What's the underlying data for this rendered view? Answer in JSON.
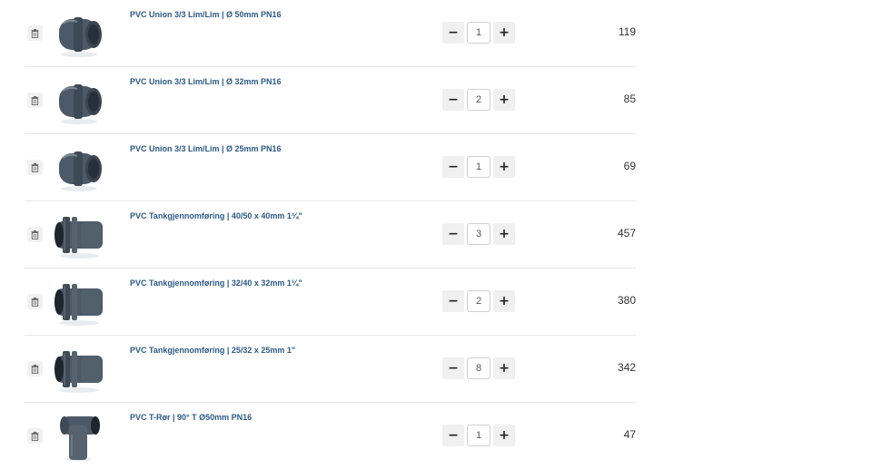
{
  "cart": {
    "items": [
      {
        "name": "PVC Union 3/3 Lim/Lim | Ø 50mm PN16",
        "quantity": "1",
        "price": "119",
        "image": "pvc-union-icon"
      },
      {
        "name": "PVC Union 3/3 Lim/Lim | Ø 32mm PN16",
        "quantity": "2",
        "price": "85",
        "image": "pvc-union-icon"
      },
      {
        "name": "PVC Union 3/3 Lim/Lim | Ø 25mm PN16",
        "quantity": "1",
        "price": "69",
        "image": "pvc-union-icon"
      },
      {
        "name": "PVC Tankgjennomføring | 40/50 x 40mm 1¼\"",
        "quantity": "3",
        "price": "457",
        "image": "tank-fitting-icon"
      },
      {
        "name": "PVC Tankgjennomføring | 32/40 x 32mm 1¼\"",
        "quantity": "2",
        "price": "380",
        "image": "tank-fitting-icon"
      },
      {
        "name": "PVC Tankgjennomføring | 25/32 x 25mm 1\"",
        "quantity": "8",
        "price": "342",
        "image": "tank-fitting-icon"
      },
      {
        "name": "PVC T-Rør | 90° T Ø50mm PN16",
        "quantity": "1",
        "price": "47",
        "image": "tee-pipe-icon"
      }
    ],
    "decrement_label": "−",
    "increment_label": "+",
    "delete_icon": "trash-icon"
  },
  "colors": {
    "link": "#2c5a86",
    "product": "#4c5a68",
    "button_bg": "#f0f0f0"
  }
}
